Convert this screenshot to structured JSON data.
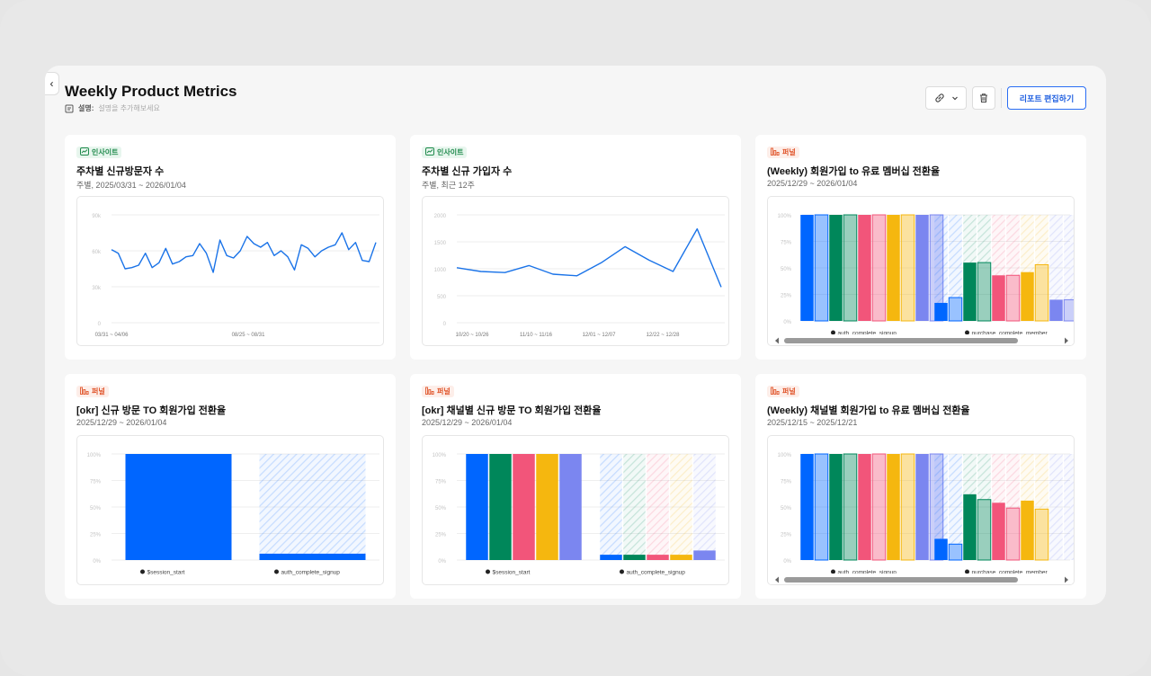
{
  "report": {
    "title": "Weekly Product Metrics",
    "description_label": "설명:",
    "description_placeholder": "설명을 추가해보세요",
    "edit_button": "리포트 편집하기"
  },
  "cards": [
    {
      "tag": "인사이트",
      "title": "주차별 신규방문자 수",
      "subtitle": "주별, 2025/03/31 ~ 2026/01/04",
      "chart_data": {
        "type": "line",
        "x_tick_labels": [
          "03/31 ~ 04/06",
          "08/25 ~ 08/31"
        ],
        "y_tick_labels": [
          "90k",
          "60k",
          "30k",
          "0"
        ],
        "ylim": [
          0,
          90000
        ],
        "values": [
          61000,
          58000,
          45000,
          46000,
          48000,
          58000,
          46000,
          50000,
          62000,
          49000,
          51000,
          55000,
          56000,
          66000,
          58000,
          42000,
          69000,
          56000,
          54000,
          60000,
          72000,
          66000,
          63000,
          67000,
          56000,
          60000,
          55000,
          44000,
          65000,
          62000,
          55000,
          60000,
          63000,
          65000,
          75000,
          61000,
          67000,
          52000,
          51000,
          67000
        ],
        "color": "#1a73e8"
      }
    },
    {
      "tag": "인사이트",
      "title": "주차별 신규 가입자 수",
      "subtitle": "주별, 최근 12주",
      "chart_data": {
        "type": "line",
        "x_tick_labels": [
          "10/20 ~ 10/26",
          "11/10 ~ 11/16",
          "12/01 ~ 12/07",
          "12/22 ~ 12/28"
        ],
        "y_tick_labels": [
          "2000",
          "1500",
          "1000",
          "500",
          "0"
        ],
        "ylim": [
          0,
          2000
        ],
        "values": [
          1020,
          950,
          930,
          1060,
          900,
          870,
          1110,
          1410,
          1160,
          950,
          1740,
          660
        ],
        "color": "#1a73e8"
      }
    },
    {
      "tag": "퍼널",
      "title": "(Weekly) 회원가입 to 유료 멤버십 전환율",
      "subtitle": "2025/12/29 ~ 2026/01/04",
      "chart_data": {
        "type": "bar",
        "y_tick_labels": [
          "100%",
          "75%",
          "50%",
          "25%",
          "0%"
        ],
        "ylim": [
          0,
          100
        ],
        "steps": [
          "auth_complete_signup",
          "purchase_complete_member"
        ],
        "colors": [
          "#0066ff",
          "#00875a",
          "#f2557a",
          "#f5b70f",
          "#7b86f0"
        ],
        "series_values": [
          [
            100,
            100,
            100,
            100,
            100,
            100,
            100,
            100,
            100,
            100
          ],
          [
            17,
            22,
            55,
            55,
            43,
            43,
            46,
            53,
            20,
            20
          ]
        ],
        "light_pattern": [
          false,
          true,
          false,
          true,
          false,
          true,
          false,
          true,
          false,
          true
        ]
      }
    },
    {
      "tag": "퍼널",
      "title": "[okr] 신규 방문 TO 회원가입 전환율",
      "subtitle": "2025/12/29 ~ 2026/01/04",
      "chart_data": {
        "type": "bar",
        "y_tick_labels": [
          "100%",
          "75%",
          "50%",
          "25%",
          "0%"
        ],
        "ylim": [
          0,
          100
        ],
        "steps": [
          "$session_start",
          "auth_complete_signup"
        ],
        "colors": [
          "#0066ff"
        ],
        "series_values": [
          [
            100
          ],
          [
            6
          ]
        ]
      }
    },
    {
      "tag": "퍼널",
      "title": "[okr] 채널별 신규 방문 TO 회원가입 전환율",
      "subtitle": "2025/12/29 ~ 2026/01/04",
      "chart_data": {
        "type": "bar",
        "y_tick_labels": [
          "100%",
          "75%",
          "50%",
          "25%",
          "0%"
        ],
        "ylim": [
          0,
          100
        ],
        "steps": [
          "$session_start",
          "auth_complete_signup"
        ],
        "colors": [
          "#0066ff",
          "#00875a",
          "#f2557a",
          "#f5b70f",
          "#7b86f0"
        ],
        "series_values": [
          [
            100,
            100,
            100,
            100,
            100
          ],
          [
            5,
            5,
            5,
            5,
            9
          ]
        ]
      }
    },
    {
      "tag": "퍼널",
      "title": "(Weekly) 채널별 회원가입 to 유료 멤버십 전환율",
      "subtitle": "2025/12/15 ~ 2025/12/21",
      "chart_data": {
        "type": "bar",
        "y_tick_labels": [
          "100%",
          "75%",
          "50%",
          "25%",
          "0%"
        ],
        "ylim": [
          0,
          100
        ],
        "steps": [
          "auth_complete_signup",
          "purchase_complete_member"
        ],
        "colors": [
          "#0066ff",
          "#00875a",
          "#f2557a",
          "#f5b70f",
          "#7b86f0"
        ],
        "series_values": [
          [
            100,
            100,
            100,
            100,
            100,
            100,
            100,
            100,
            100,
            100
          ],
          [
            20,
            15,
            62,
            57,
            54,
            49,
            56,
            48,
            0,
            0
          ]
        ],
        "light_pattern": [
          false,
          true,
          false,
          true,
          false,
          true,
          false,
          true,
          false,
          true
        ]
      }
    }
  ]
}
